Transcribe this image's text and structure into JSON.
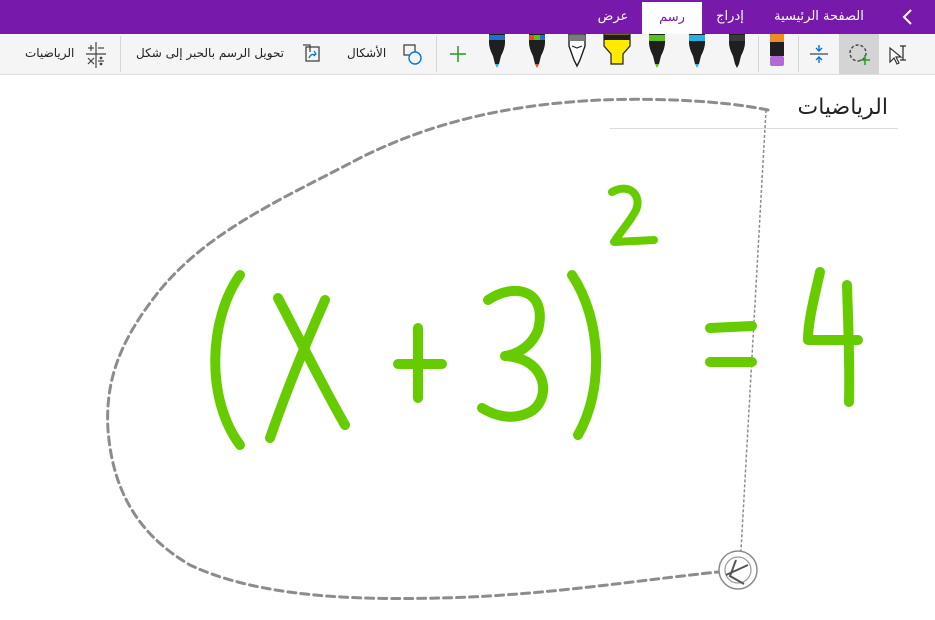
{
  "tabs": {
    "home": "الصفحة الرئيسية",
    "insert": "إدراج",
    "draw": "رسم",
    "view": "عرض"
  },
  "toolbar": {
    "math_label": "الرياضيات",
    "ink_to_shape_label": "تحويل الرسم بالحبر إلى شكل",
    "shapes_label": "الأشكال"
  },
  "pens": [
    {
      "kind": "pen",
      "color": "#1f1f1f"
    },
    {
      "kind": "pen",
      "color": "#26b1e6"
    },
    {
      "kind": "pen",
      "color": "#5cbf1e"
    },
    {
      "kind": "highlighter",
      "color": "#ffeb00"
    },
    {
      "kind": "pencil",
      "color": "#7a7a7a"
    },
    {
      "kind": "pen",
      "color": "#e84a1f"
    },
    {
      "kind": "pen",
      "color": "#1f6fd1"
    }
  ],
  "page": {
    "title": "الرياضيات"
  },
  "colors": {
    "brand": "#7719aa",
    "ink": "#66cc00",
    "lasso": "#8c8c8c"
  },
  "icons": [
    "chevron-left-icon",
    "type-select-icon",
    "lasso-select-icon",
    "insert-space-icon",
    "eraser-icon",
    "add-pen-icon",
    "shapes-icon",
    "ink-to-shape-icon",
    "math-icon",
    "rotate-handle-icon"
  ]
}
